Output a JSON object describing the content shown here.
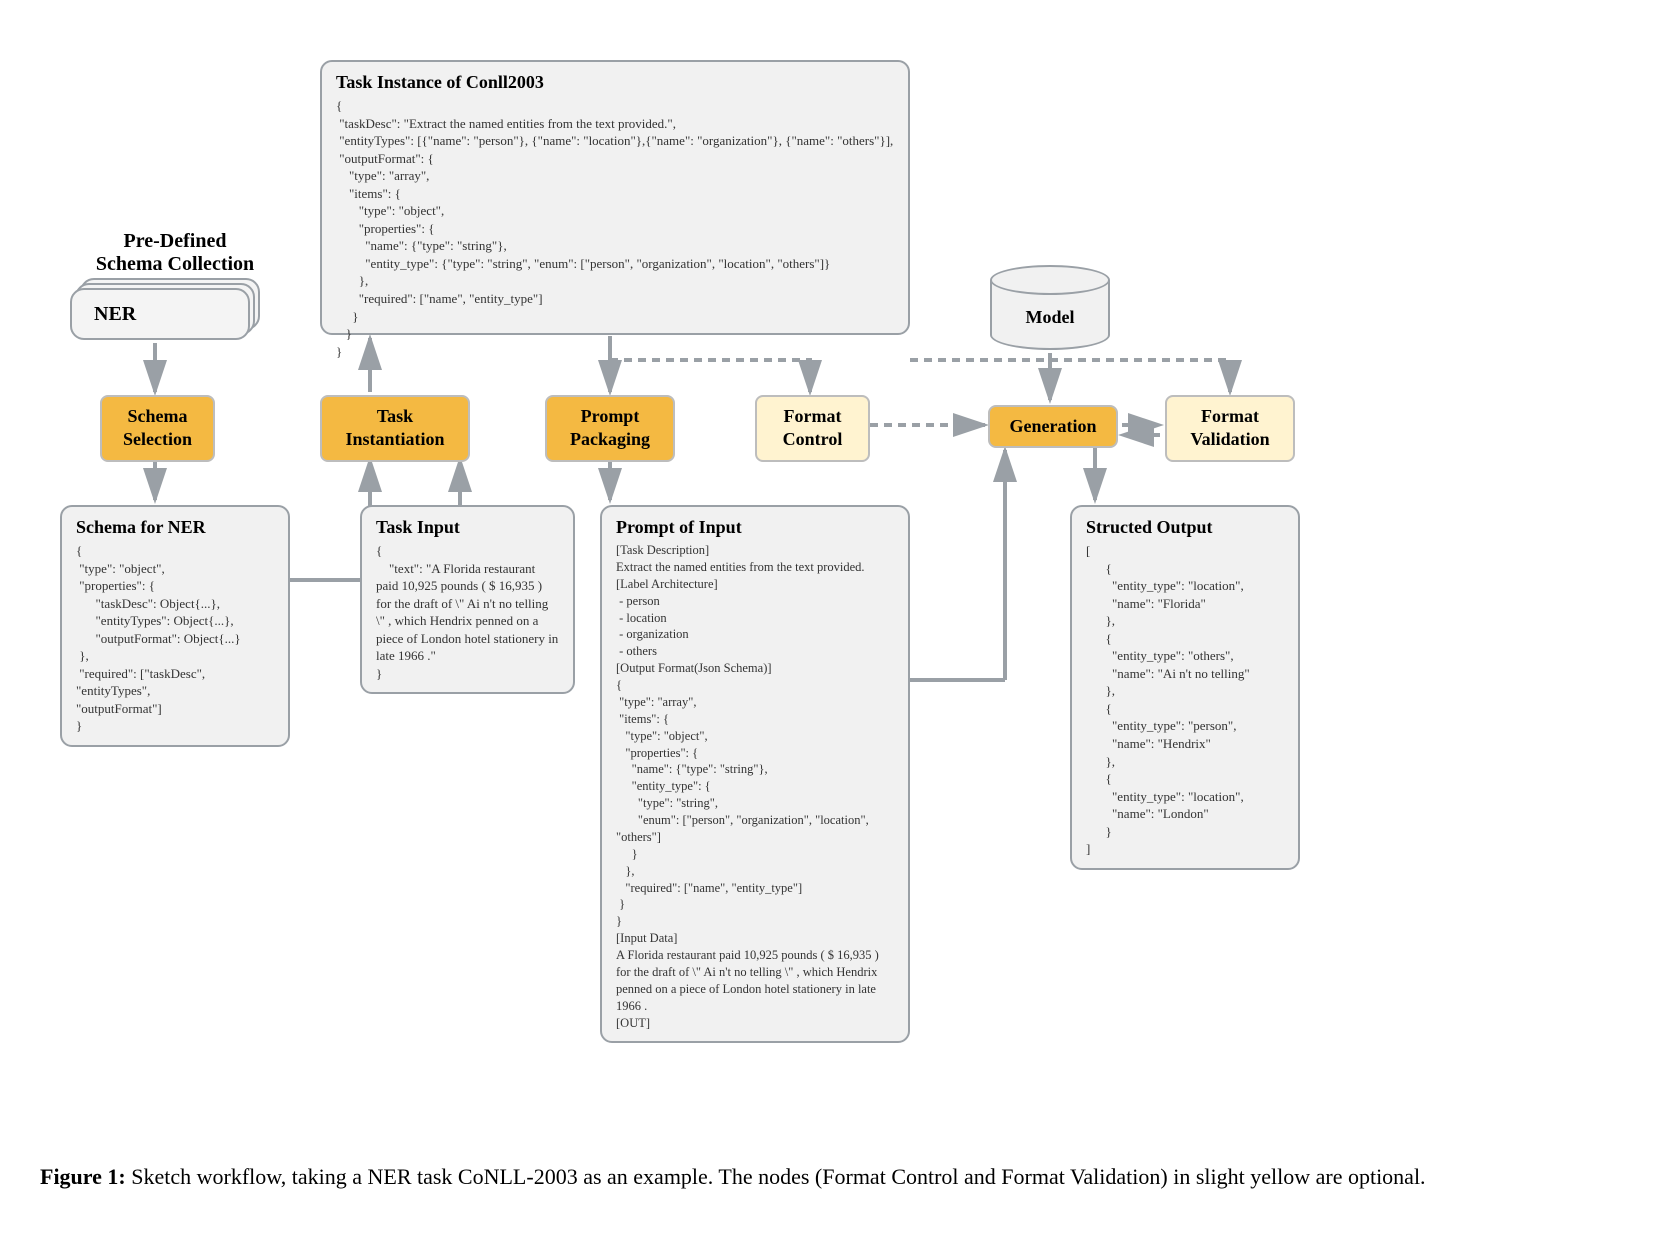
{
  "header": {
    "predefined_label": "Pre-Defined\nSchema Collection",
    "ner_pill": "NER",
    "model_label": "Model"
  },
  "steps": {
    "schema_selection": "Schema\nSelection",
    "task_instantiation": "Task\nInstantiation",
    "prompt_packaging": "Prompt\nPackaging",
    "format_control": "Format\nControl",
    "generation": "Generation",
    "format_validation": "Format\nValidation"
  },
  "task_instance": {
    "title": "Task Instance of Conll2003",
    "body": "{\n \"taskDesc\": \"Extract the named entities from the text provided.\",\n \"entityTypes\": [{\"name\": \"person\"}, {\"name\": \"location\"},{\"name\": \"organization\"}, {\"name\": \"others\"}],\n \"outputFormat\": {\n    \"type\": \"array\",\n    \"items\": {\n       \"type\": \"object\",\n       \"properties\": {\n         \"name\": {\"type\": \"string\"},\n         \"entity_type\": {\"type\": \"string\", \"enum\": [\"person\", \"organization\", \"location\", \"others\"]}\n       },\n       \"required\": [\"name\", \"entity_type\"]\n     }\n   }\n}"
  },
  "schema_ner": {
    "title": "Schema for NER",
    "body": "{\n \"type\": \"object\",\n \"properties\": {\n      \"taskDesc\": Object{...},\n      \"entityTypes\": Object{...},\n      \"outputFormat\": Object{...}\n },\n \"required\": [\"taskDesc\", \"entityTypes\",\n\"outputFormat\"]\n}"
  },
  "task_input": {
    "title": "Task Input",
    "body": "{\n    \"text\": \"A Florida restaurant paid 10,925 pounds ( $ 16,935 ) for the draft of \\\" Ai n't no telling \\\" , which Hendrix penned on a piece of London hotel stationery in late 1966 .\"\n}"
  },
  "prompt_box": {
    "title": "Prompt of Input",
    "body": "[Task Description]\nExtract the named entities from the text provided.\n[Label Architecture]\n - person\n - location\n - organization\n - others\n[Output Format(Json Schema)]\n{\n \"type\": \"array\",\n \"items\": {\n   \"type\": \"object\",\n   \"properties\": {\n     \"name\": {\"type\": \"string\"},\n     \"entity_type\": {\n       \"type\": \"string\",\n       \"enum\": [\"person\", \"organization\", \"location\", \"others\"]\n     }\n   },\n   \"required\": [\"name\", \"entity_type\"]\n }\n}\n[Input Data]\nA Florida restaurant paid 10,925 pounds ( $ 16,935 ) for the draft of \\\" Ai n't no telling \\\" , which Hendrix penned on a piece of London hotel stationery in late 1966 .\n[OUT]"
  },
  "structured_output": {
    "title": "Structed Output",
    "body": "[\n      {\n        \"entity_type\": \"location\",\n        \"name\": \"Florida\"\n      },\n      {\n        \"entity_type\": \"others\",\n        \"name\": \"Ai n't no telling\"\n      },\n      {\n        \"entity_type\": \"person\",\n        \"name\": \"Hendrix\"\n      },\n      {\n        \"entity_type\": \"location\",\n        \"name\": \"London\"\n      }\n]"
  },
  "caption": {
    "label": "Figure 1:",
    "text": " Sketch workflow, taking a NER task CoNLL-2003 as an example. The nodes (Format Control and Format Validation) in slight yellow are optional."
  }
}
